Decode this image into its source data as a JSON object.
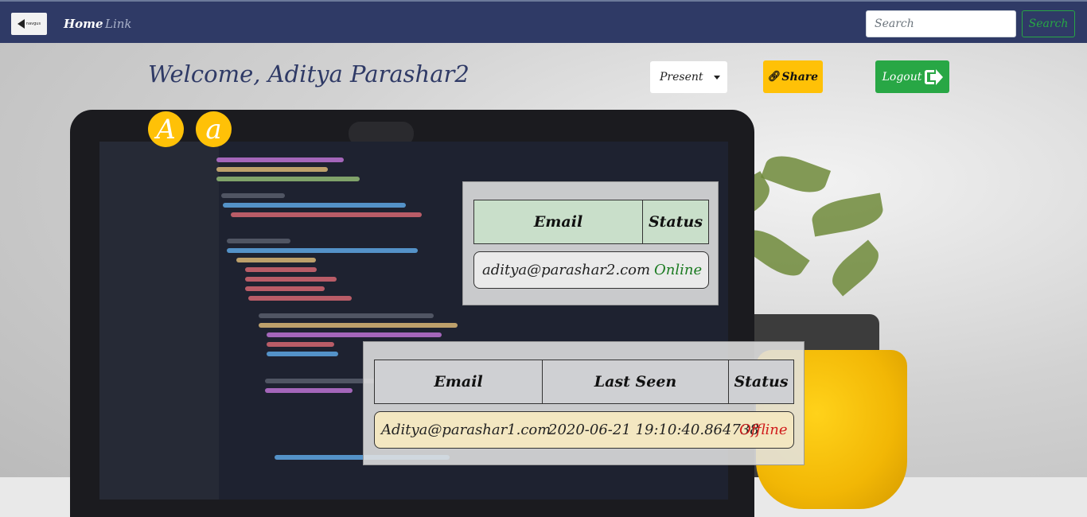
{
  "navbar": {
    "brand_text": "navgus",
    "home_label": "Home",
    "link_label": "Link",
    "search_placeholder": "Search",
    "search_button": "Search"
  },
  "header": {
    "welcome": "Welcome, Aditya Parashar2",
    "presence_selected": "Present",
    "share_label": "Share",
    "logout_label": "Logout"
  },
  "font_toggles": {
    "large": "A",
    "small": "a"
  },
  "online_table": {
    "columns": [
      "Email",
      "Status"
    ],
    "rows": [
      {
        "email": "aditya@parashar2.com",
        "status": "Online"
      }
    ]
  },
  "offline_table": {
    "columns": [
      "Email",
      "Last Seen",
      "Status"
    ],
    "rows": [
      {
        "email": "Aditya@parashar1.com",
        "last_seen": "2020-06-21 19:10:40.864738",
        "status": "Offline"
      }
    ]
  },
  "colors": {
    "navbar": "#2f3a66",
    "share": "#ffc107",
    "logout": "#28a745",
    "online": "#1c7b22",
    "offline": "#d01c1c"
  }
}
